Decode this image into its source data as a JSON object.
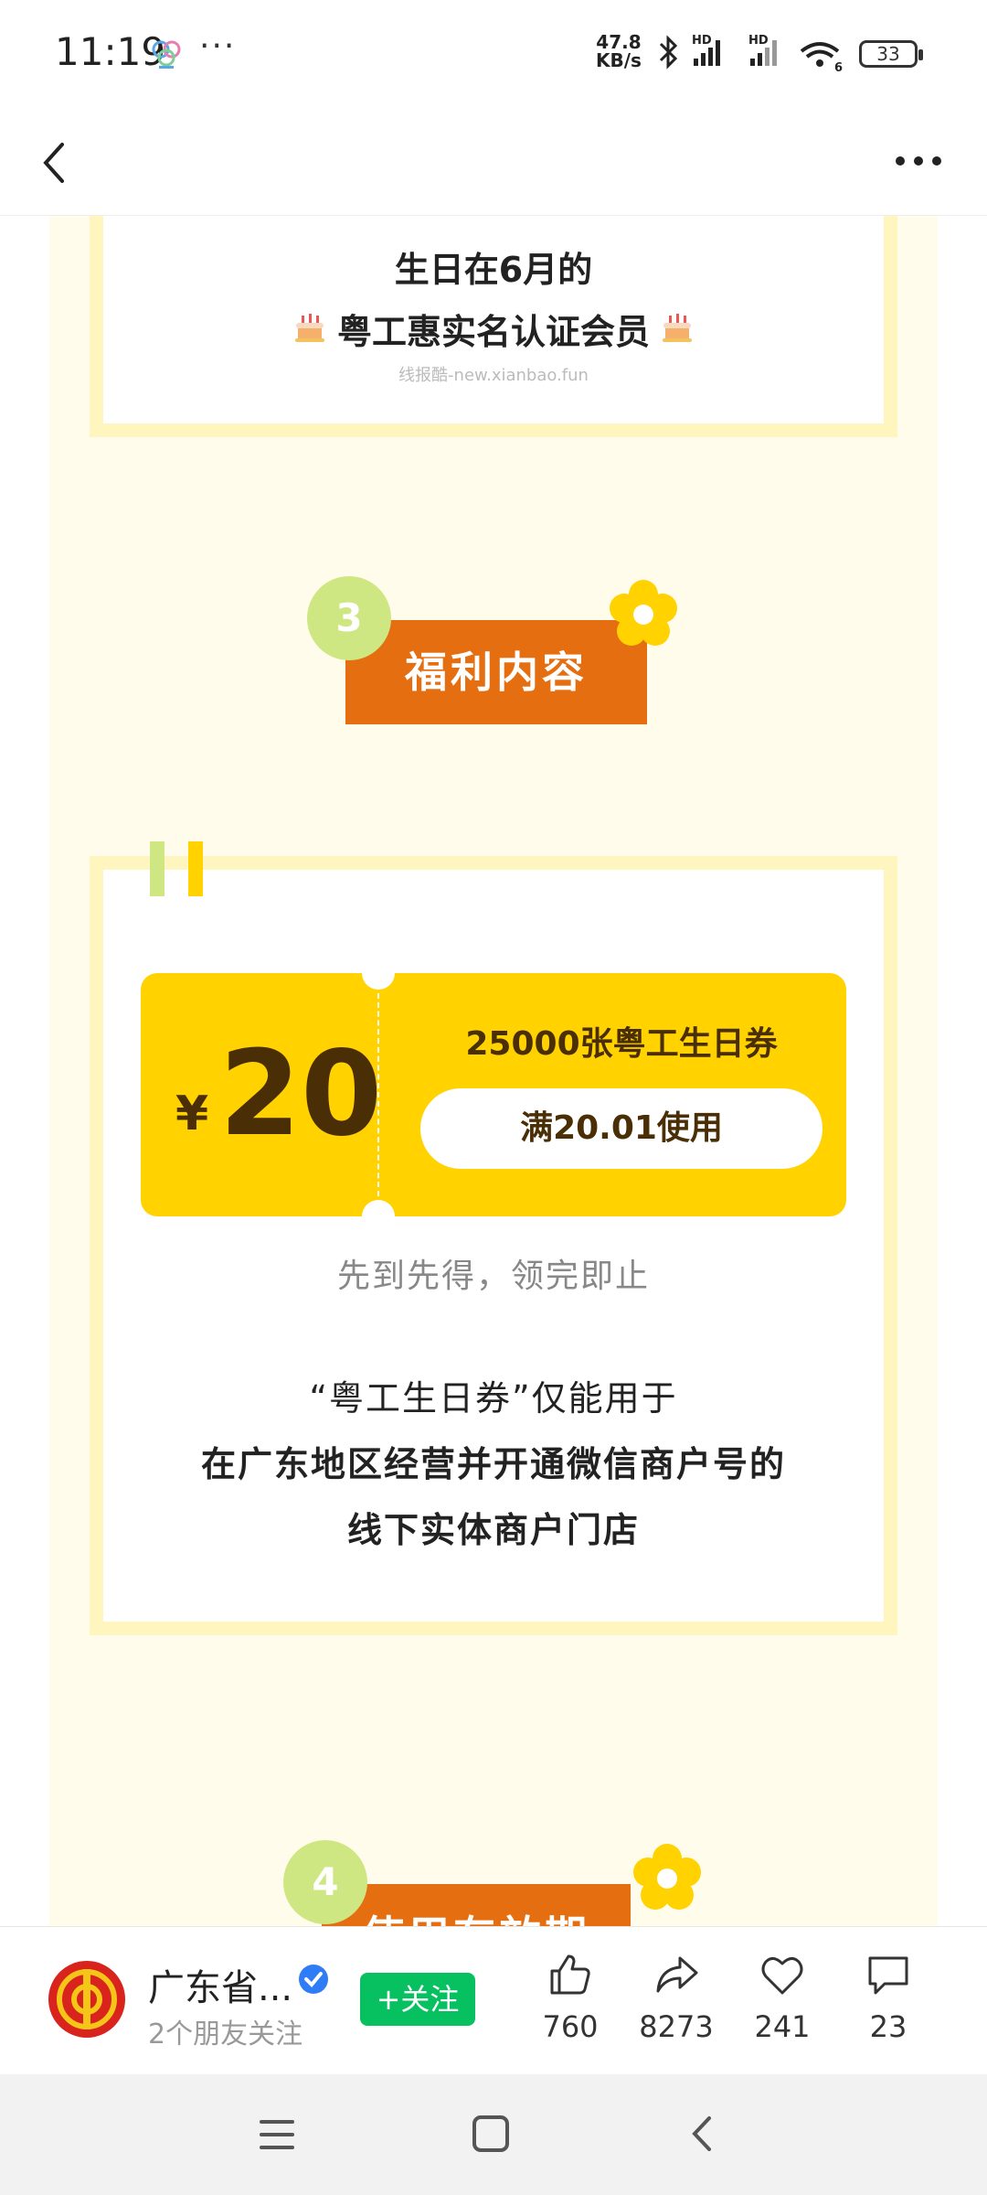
{
  "status_bar": {
    "time": "11:19",
    "more": "···",
    "net_speed_value": "47.8",
    "net_speed_unit": "KB/s",
    "hd1": "HD",
    "hd2": "HD",
    "wifi_tag": "6",
    "battery": "33"
  },
  "nav": {
    "back_icon": "chevron-left-icon",
    "more_icon": "more-horizontal-icon"
  },
  "content": {
    "top_card": {
      "line1": "生日在6月的",
      "line2": "粤工惠实名认证会员",
      "cake_icon": "birthday-cake-icon",
      "watermark": "线报酷-new.xianbao.fun"
    },
    "section3": {
      "number": "3",
      "title": "福利内容"
    },
    "coupon": {
      "currency": "¥",
      "amount": "20",
      "name": "25000张粤工生日券",
      "condition": "满20.01使用"
    },
    "coupon_note": "先到先得，领完即止",
    "description": {
      "line1": "“粤工生日券”仅能用于",
      "line2": "在广东地区经营并开通微信商户号的",
      "line3": "线下实体商户门店"
    },
    "section4": {
      "number": "4",
      "title": "使用有效期"
    }
  },
  "bottom_bar": {
    "account_name": "广东省...",
    "friends_follow": "2个朋友关注",
    "follow_button": "+关注",
    "likes": "760",
    "shares": "8273",
    "favorites": "241",
    "comments": "23"
  },
  "colors": {
    "accent_orange": "#e56f10",
    "coupon_yellow": "#ffd200",
    "badge_green": "#cfe783",
    "follow_green": "#07c160",
    "cream_bg": "#fffcec",
    "card_border": "#fff6bf"
  }
}
